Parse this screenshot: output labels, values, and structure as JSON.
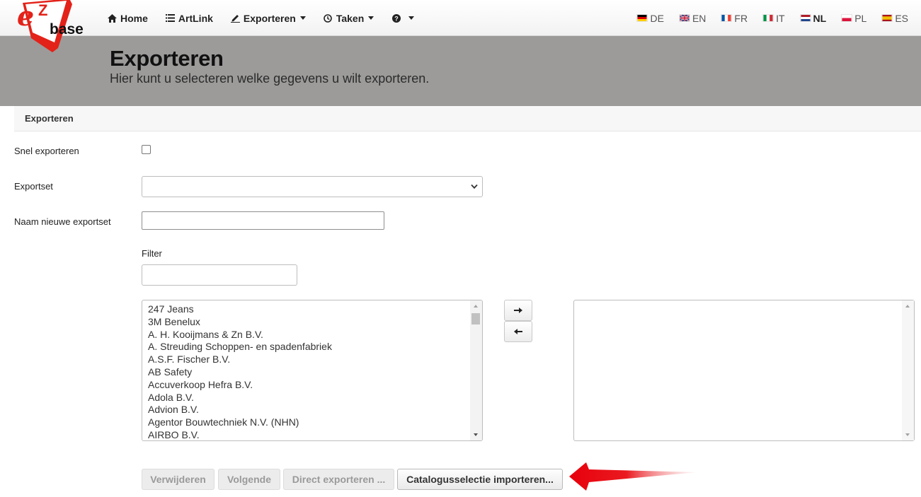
{
  "brand": {
    "logo_letter": "e",
    "logo_z": "Z",
    "logo_text": "base"
  },
  "nav": {
    "items": [
      {
        "label": "Home",
        "icon": "home-icon"
      },
      {
        "label": "ArtLink",
        "icon": "list-icon"
      },
      {
        "label": "Exporteren",
        "icon": "signature-icon",
        "dropdown": true
      },
      {
        "label": "Taken",
        "icon": "clock-icon",
        "dropdown": true
      },
      {
        "label": "",
        "icon": "question-circle-icon",
        "dropdown": true
      }
    ]
  },
  "languages": [
    {
      "code": "DE",
      "flag": "germany-flag-icon",
      "active": false
    },
    {
      "code": "EN",
      "flag": "uk-flag-icon",
      "active": false
    },
    {
      "code": "FR",
      "flag": "france-flag-icon",
      "active": false
    },
    {
      "code": "IT",
      "flag": "italy-flag-icon",
      "active": false
    },
    {
      "code": "NL",
      "flag": "netherlands-flag-icon",
      "active": true
    },
    {
      "code": "PL",
      "flag": "poland-flag-icon",
      "active": false
    },
    {
      "code": "ES",
      "flag": "spain-flag-icon",
      "active": false
    }
  ],
  "header": {
    "title": "Exporteren",
    "subtitle": "Hier kunt u selecteren welke gegevens u wilt exporteren."
  },
  "card": {
    "title": "Exporteren"
  },
  "form": {
    "quick_export_label": "Snel exporteren",
    "quick_export_checked": false,
    "exportset_label": "Exportset",
    "exportset_value": "",
    "new_exportset_label": "Naam nieuwe exportset",
    "new_exportset_value": "",
    "filter_label": "Filter",
    "filter_value": ""
  },
  "available_list": [
    "247 Jeans",
    "3M Benelux",
    "A. H. Kooijmans & Zn B.V.",
    "A. Streuding Schoppen- en spadenfabriek",
    "A.S.F. Fischer B.V.",
    "AB Safety",
    "Accuverkoop Hefra B.V.",
    "Adola B.V.",
    "Advion B.V.",
    "Agentor Bouwtechniek N.V. (NHN)",
    "AIRBO B.V."
  ],
  "selected_list": [],
  "buttons": {
    "delete": "Verwijderen",
    "next": "Volgende",
    "direct_export": "Direct exporteren ...",
    "import_catalog": "Catalogusselectie importeren..."
  },
  "colors": {
    "hero_bg": "#9c9b9a",
    "logo_red": "#e32219",
    "highlight_arrow": "#e8000b"
  }
}
